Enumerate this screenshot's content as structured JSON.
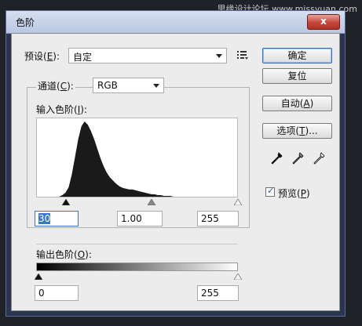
{
  "watermark": "思缘设计论坛 www.missyuan.com",
  "window": {
    "title": "色阶",
    "close_label": "x"
  },
  "preset": {
    "label_prefix": "预设(",
    "label_key": "E",
    "label_suffix": "):",
    "value": "自定"
  },
  "buttons": {
    "ok": "确定",
    "reset": "复位",
    "auto_prefix": "自动(",
    "auto_key": "A",
    "auto_suffix": ")",
    "options_prefix": "选项(",
    "options_key": "T",
    "options_suffix": ")..."
  },
  "channel": {
    "label_prefix": "通道(",
    "label_key": "C",
    "label_suffix": "):",
    "value": "RGB"
  },
  "input_levels": {
    "label_prefix": "输入色阶(",
    "label_key": "I",
    "label_suffix": "):",
    "black": "30",
    "gamma": "1.00",
    "white": "255"
  },
  "output_levels": {
    "label_prefix": "输出色阶(",
    "label_key": "O",
    "label_suffix": "):",
    "black": "0",
    "white": "255"
  },
  "preview": {
    "label_prefix": "预览(",
    "label_key": "P",
    "label_suffix": ")",
    "checked": true
  },
  "icons": {
    "menu": "preset-options-menu-icon",
    "pickers": [
      "black-eyedropper-icon",
      "gray-eyedropper-icon",
      "white-eyedropper-icon"
    ]
  },
  "histogram": {
    "type": "area",
    "x_range": [
      0,
      255
    ],
    "values": [
      0,
      0,
      0,
      0,
      0,
      0,
      0,
      0,
      2,
      5,
      12,
      28,
      50,
      72,
      88,
      94,
      90,
      82,
      72,
      60,
      48,
      38,
      30,
      24,
      20,
      16,
      13,
      11,
      10,
      9,
      9,
      8,
      7,
      6,
      5,
      4,
      3,
      3,
      2,
      2,
      1,
      1,
      1,
      0,
      0,
      0,
      0,
      0,
      0,
      0,
      0,
      0,
      0,
      0,
      0,
      0,
      0,
      0,
      0,
      0,
      0,
      0,
      0,
      0
    ]
  }
}
